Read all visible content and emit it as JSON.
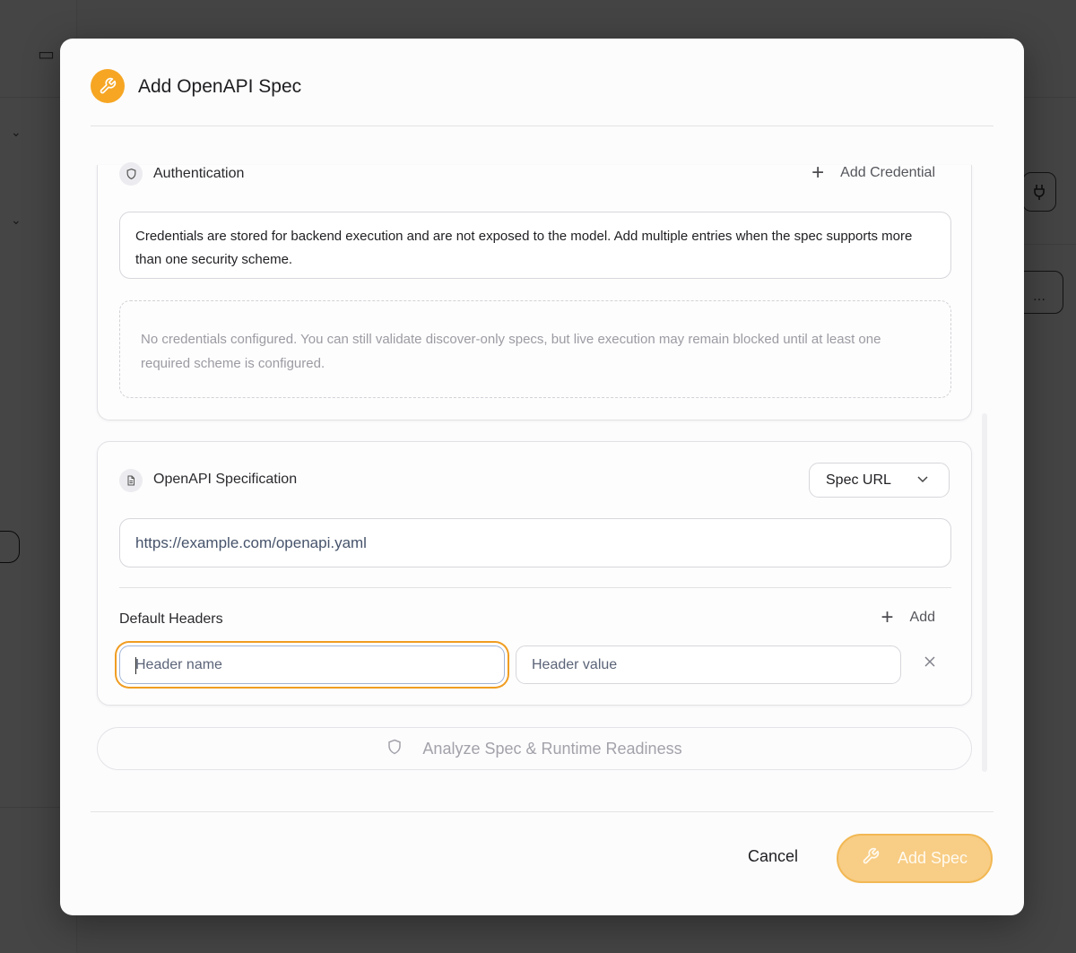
{
  "modal": {
    "title": "Add OpenAPI Spec",
    "header_icon": "wrench-icon"
  },
  "auth": {
    "title": "Authentication",
    "icon": "shield-icon",
    "add_credential": "Add Credential",
    "info": "Credentials are stored for backend execution and are not exposed to the model. Add multiple entries when the spec supports more than one security scheme.",
    "empty": "No credentials configured. You can still validate discover-only specs, but live execution may remain blocked until at least one required scheme is configured."
  },
  "spec": {
    "title": "OpenAPI Specification",
    "icon": "file-icon",
    "source_selected": "Spec URL",
    "url_value": "https://example.com/openapi.yaml",
    "headers_label": "Default Headers",
    "add_label": "Add",
    "header_name_placeholder": "Header name",
    "header_value_placeholder": "Header value"
  },
  "analyze": {
    "label": "Analyze Spec & Runtime Readiness"
  },
  "footer": {
    "cancel": "Cancel",
    "add_spec": "Add Spec"
  },
  "colors": {
    "accent": "#f6a623",
    "accent_disabled": "#f8cd85",
    "focus_ring": "#f09d22"
  }
}
